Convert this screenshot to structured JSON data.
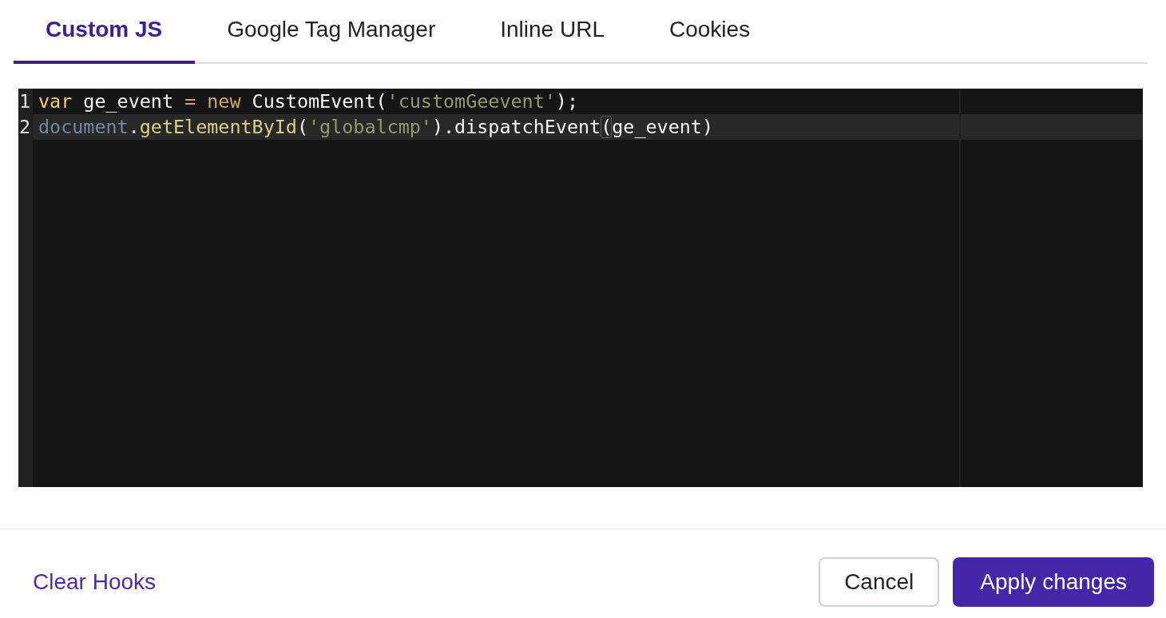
{
  "tabs": [
    {
      "label": "Custom JS",
      "selected": true
    },
    {
      "label": "Google Tag Manager",
      "selected": false
    },
    {
      "label": "Inline URL",
      "selected": false
    },
    {
      "label": "Cookies",
      "selected": false
    }
  ],
  "editor": {
    "lines": [
      {
        "number": "1",
        "active": false,
        "tokens": [
          {
            "kind": "storage",
            "text": "var"
          },
          {
            "kind": "plain",
            "text": " ge_event "
          },
          {
            "kind": "keyword",
            "text": "="
          },
          {
            "kind": "keyword",
            "text": " new"
          },
          {
            "kind": "plain",
            "text": " CustomEvent("
          },
          {
            "kind": "string",
            "text": "'customGeevent'"
          },
          {
            "kind": "plain",
            "text": ");"
          }
        ]
      },
      {
        "number": "2",
        "active": true,
        "tokens": [
          {
            "kind": "variable",
            "text": "document"
          },
          {
            "kind": "plain",
            "text": "."
          },
          {
            "kind": "function",
            "text": "getElementById"
          },
          {
            "kind": "plain",
            "text": "("
          },
          {
            "kind": "string",
            "text": "'globalcmp'"
          },
          {
            "kind": "plain",
            "text": ").dispatchEvent"
          },
          {
            "kind": "plain",
            "text": "(",
            "matched": true
          },
          {
            "kind": "plain",
            "text": "ge_event)"
          }
        ]
      }
    ]
  },
  "footer": {
    "link": "Clear Hooks",
    "buttons": [
      {
        "label": "Cancel",
        "kind": "secondary"
      },
      {
        "label": "Apply changes",
        "kind": "primary"
      }
    ]
  }
}
